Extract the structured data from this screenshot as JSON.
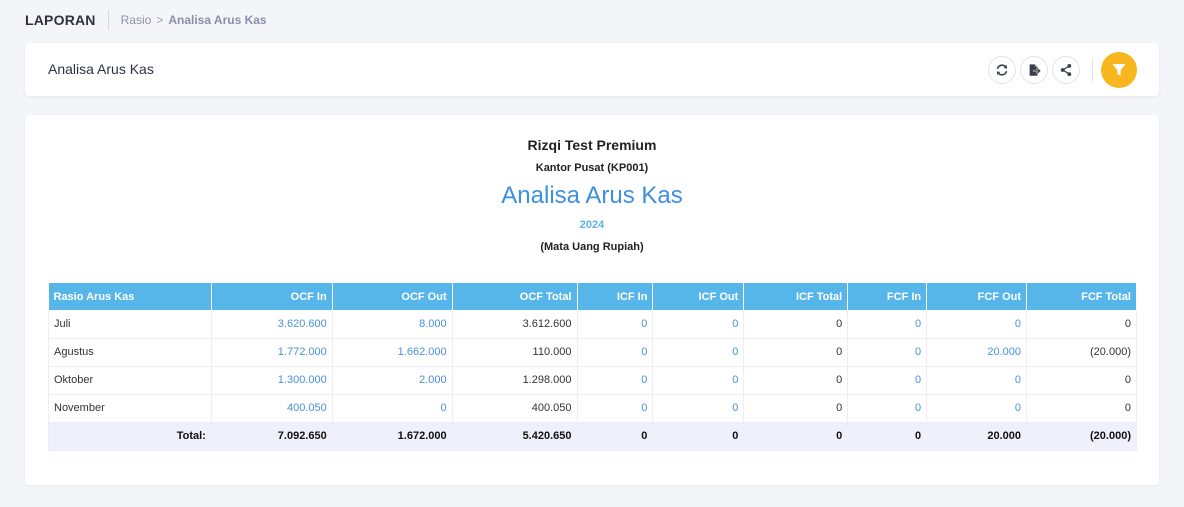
{
  "topbar": {
    "section": "LAPORAN",
    "breadcrumb": {
      "parent": "Rasio",
      "separator": ">",
      "current": "Analisa Arus Kas"
    }
  },
  "header": {
    "title": "Analisa Arus Kas",
    "icons": [
      "refresh-icon",
      "export-icon",
      "share-icon",
      "filter-icon"
    ]
  },
  "report": {
    "company": "Rizqi Test Premium",
    "branch": "Kantor Pusat (KP001)",
    "title": "Analisa Arus Kas",
    "year": "2024",
    "currency": "(Mata Uang Rupiah)",
    "columns": [
      "Rasio Arus Kas",
      "OCF In",
      "OCF Out",
      "OCF Total",
      "ICF In",
      "ICF Out",
      "ICF Total",
      "FCF In",
      "FCF Out",
      "FCF Total"
    ],
    "rows": [
      {
        "label": "Juli",
        "cells": [
          "3.620.600",
          "8.000",
          "3.612.600",
          "0",
          "0",
          "0",
          "0",
          "0",
          "0"
        ]
      },
      {
        "label": "Agustus",
        "cells": [
          "1.772.000",
          "1.662.000",
          "110.000",
          "0",
          "0",
          "0",
          "0",
          "20.000",
          "(20.000)"
        ]
      },
      {
        "label": "Oktober",
        "cells": [
          "1.300.000",
          "2.000",
          "1.298.000",
          "0",
          "0",
          "0",
          "0",
          "0",
          "0"
        ]
      },
      {
        "label": "November",
        "cells": [
          "400.050",
          "0",
          "400.050",
          "0",
          "0",
          "0",
          "0",
          "0",
          "0"
        ]
      }
    ],
    "total": {
      "label": "Total:",
      "cells": [
        "7.092.650",
        "1.672.000",
        "5.420.650",
        "0",
        "0",
        "0",
        "0",
        "20.000",
        "(20.000)"
      ]
    }
  },
  "colors": {
    "accent": "#3d8fe0",
    "table_header": "#56b6ea",
    "filter_button": "#f7b71d",
    "link": "#4a8fdc"
  }
}
